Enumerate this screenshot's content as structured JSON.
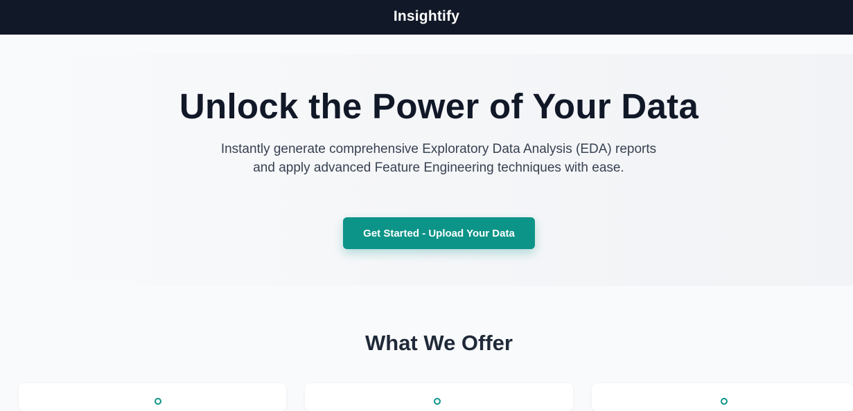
{
  "navbar": {
    "brand": "Insightify"
  },
  "hero": {
    "title": "Unlock the Power of Your Data",
    "subtitle": "Instantly generate comprehensive Exploratory Data Analysis (EDA) reports and apply advanced Feature Engineering techniques with ease.",
    "cta_label": "Get Started - Upload Your Data"
  },
  "offer": {
    "title": "What We Offer",
    "cards": [
      {
        "icon": "feature-icon"
      },
      {
        "icon": "feature-icon"
      },
      {
        "icon": "feature-icon"
      }
    ]
  },
  "colors": {
    "navbar_bg": "#111827",
    "accent": "#0d9488",
    "page_bg": "#f8fafc",
    "heading": "#111827"
  }
}
